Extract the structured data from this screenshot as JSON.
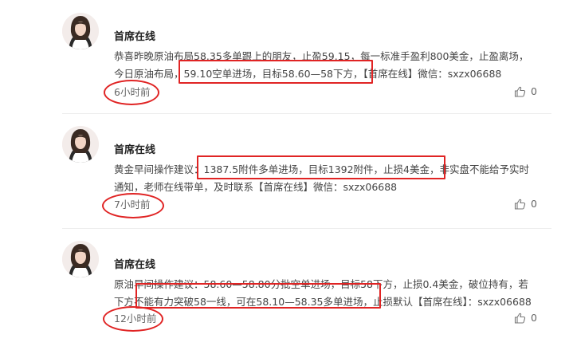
{
  "posts": [
    {
      "username": "首席在线",
      "lines": [
        "恭喜昨晚原油布局58.35多单跟上的朋友，止盈59.15，每一标准手盈利800美金，止盈离场，",
        "今日原油布局，59.10空单进场，目标58.60—58下方，【首席在线】微信：sxzx06688"
      ],
      "time": "6小时前",
      "likes": "0"
    },
    {
      "username": "首席在线",
      "lines": [
        "黄金早间操作建议：1387.5附件多单进场，目标1392附件，止损4美金，非实盘不能给予实时",
        "通知，老师在线带单，及时联系【首席在线】微信：sxzx06688"
      ],
      "time": "7小时前",
      "likes": "0"
    },
    {
      "username": "首席在线",
      "lines": [
        "原油早间操作建议：58.60—58.80分批空单进场，目标58下方，止损0.4美金，破位持有，若",
        "下方不能有力突破58一线，可在58.10—58.35多单进场，止损默认【首席在线】：sxzx06688"
      ],
      "time": "12小时前",
      "likes": "0"
    }
  ],
  "icons": {
    "like": "thumbs-up-icon",
    "avatar": "avatar"
  },
  "colors": {
    "annotation": "#e02424",
    "text": "#444444",
    "username": "#222222"
  }
}
